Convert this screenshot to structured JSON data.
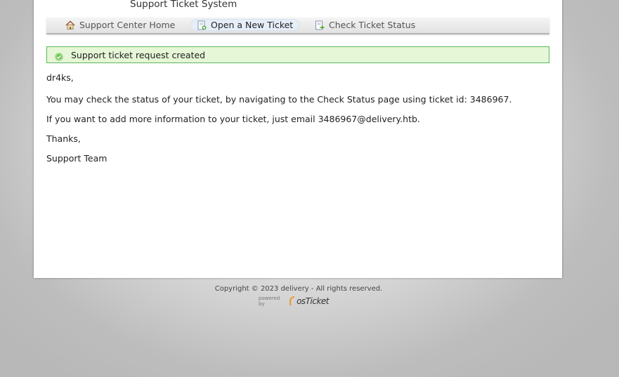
{
  "header": {
    "title": "Support Ticket System"
  },
  "nav": {
    "items": [
      {
        "label": "Support Center Home",
        "icon": "home-icon"
      },
      {
        "label": "Open a New Ticket",
        "icon": "new-ticket-icon",
        "active": true
      },
      {
        "label": "Check Ticket Status",
        "icon": "ticket-status-icon"
      }
    ]
  },
  "alert": {
    "text": "Support ticket request created",
    "icon": "check-circle-icon",
    "color": "#5cb85c"
  },
  "message": {
    "greeting": "dr4ks,",
    "line1": "You may check the status of your ticket, by navigating to the Check Status page using ticket id: 3486967.",
    "line2": "If you want to add more information to your ticket, just email 3486967@delivery.htb.",
    "thanks": "Thanks,",
    "signature": "Support Team"
  },
  "footer": {
    "copyright": "Copyright © 2023 delivery - All rights reserved.",
    "powered_by": "powered by",
    "brand": "osTicket"
  }
}
